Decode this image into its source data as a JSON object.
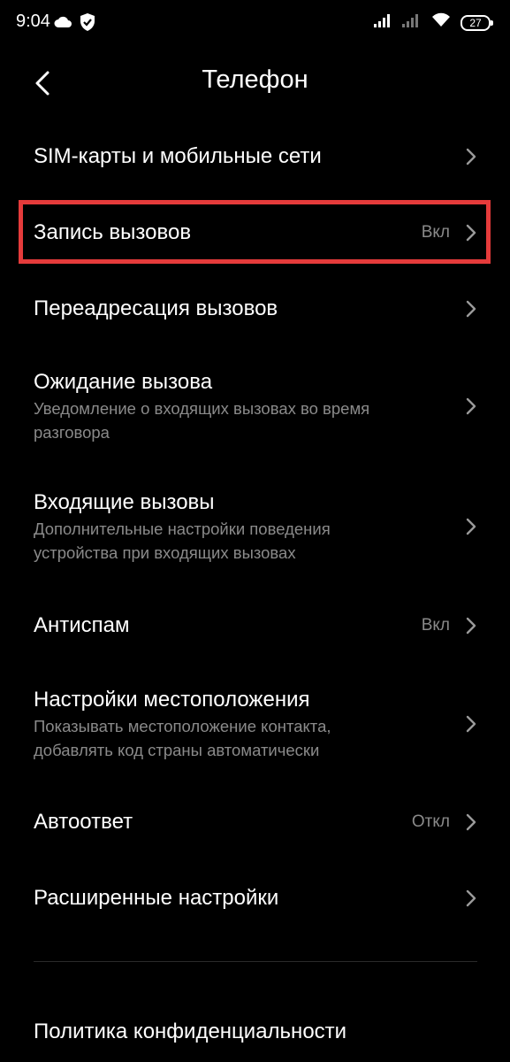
{
  "status_bar": {
    "time": "9:04",
    "battery": "27",
    "icons": [
      "cloud-icon",
      "shield-icon",
      "signal-icon",
      "signal-icon",
      "wifi-icon",
      "battery-icon"
    ]
  },
  "header": {
    "title": "Телефон",
    "back_icon": "back-arrow-icon"
  },
  "items": [
    {
      "title": "SIM-карты и мобильные сети",
      "subtitle": "",
      "value": ""
    },
    {
      "title": "Запись вызовов",
      "subtitle": "",
      "value": "Вкл"
    },
    {
      "title": "Переадресация вызовов",
      "subtitle": "",
      "value": ""
    },
    {
      "title": "Ожидание вызова",
      "subtitle_line1": "Уведомление о входящих вызовах во время",
      "subtitle_line2": "разговора",
      "value": ""
    },
    {
      "title": "Входящие вызовы",
      "subtitle_line1": "Дополнительные настройки поведения",
      "subtitle_line2": "устройства при входящих вызовах",
      "value": ""
    },
    {
      "title": "Антиспам",
      "subtitle": "",
      "value": "Вкл"
    },
    {
      "title": "Настройки местоположения",
      "subtitle_line1": "Показывать местоположение контакта,",
      "subtitle_line2": "добавлять код страны автоматически",
      "value": ""
    },
    {
      "title": "Автоответ",
      "subtitle": "",
      "value": "Откл"
    },
    {
      "title": "Расширенные настройки",
      "subtitle": "",
      "value": ""
    }
  ],
  "footer_items": [
    {
      "title": "Политика конфиденциальности"
    }
  ],
  "colors": {
    "background": "#000000",
    "primary_text": "#ffffff",
    "secondary_text": "#8a8a8a",
    "highlight": "#e53b3b",
    "divider": "#2a2a2a"
  }
}
